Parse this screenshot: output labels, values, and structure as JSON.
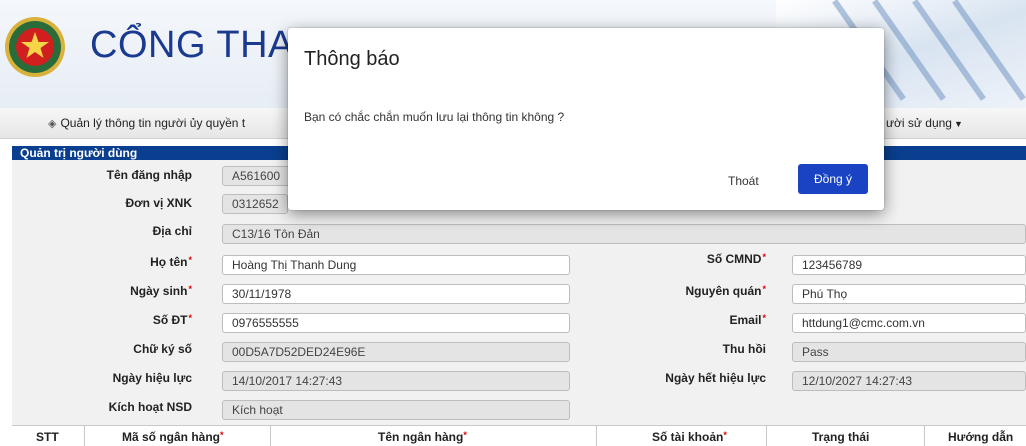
{
  "header": {
    "title": "CỔNG THANH"
  },
  "nav": {
    "items": [
      {
        "label": "Quản lý thông tin người ủy quyền t",
        "icon": "diamond-icon"
      },
      {
        "label": "ười sử dụng",
        "icon": "chevron-down-icon"
      }
    ]
  },
  "panel": {
    "title": "Quản trị người dùng",
    "fields": {
      "username": {
        "label": "Tên đăng nhập",
        "value": "A561600"
      },
      "unit": {
        "label": "Đơn vị XNK",
        "value": "0312652"
      },
      "address": {
        "label": "Địa chỉ",
        "value": "C13/16 Tôn Đản"
      },
      "fullname": {
        "label": "Họ tên",
        "value": "Hoàng Thị Thanh Dung"
      },
      "birthdate": {
        "label": "Ngày sinh",
        "value": "30/11/1978"
      },
      "phone": {
        "label": "Số ĐT",
        "value": "0976555555"
      },
      "signature": {
        "label": "Chữ ký số",
        "value": "00D5A7D52DED24E96E"
      },
      "effective": {
        "label": "Ngày hiệu lực",
        "value": "14/10/2017 14:27:43"
      },
      "activate": {
        "label": "Kích hoạt NSD",
        "value": "Kích hoạt"
      },
      "cmnd": {
        "label": "Số CMND",
        "value": "123456789"
      },
      "hometown": {
        "label": "Nguyên quán",
        "value": "Phú Thọ"
      },
      "email": {
        "label": "Email",
        "value": "httdung1@cmc.com.vn"
      },
      "revoke": {
        "label": "Thu hồi",
        "value": "Pass"
      },
      "expiry": {
        "label": "Ngày hết hiệu lực",
        "value": "12/10/2027 14:27:43"
      }
    },
    "required_mark": "*"
  },
  "table": {
    "columns": [
      "STT",
      "Mã số ngân hàng",
      "Tên ngân hàng",
      "Số tài khoản",
      "Trạng thái",
      "Hướng dẫn"
    ]
  },
  "dialog": {
    "title": "Thông báo",
    "message": "Bạn có chắc chắn muốn lưu lại thông tin không ?",
    "exit_label": "Thoát",
    "ok_label": "Đồng ý"
  },
  "colors": {
    "brand": "#1a3a8f",
    "panel_header": "#0a3f8f",
    "primary_button": "#1a43c4",
    "required": "#dd0000"
  }
}
